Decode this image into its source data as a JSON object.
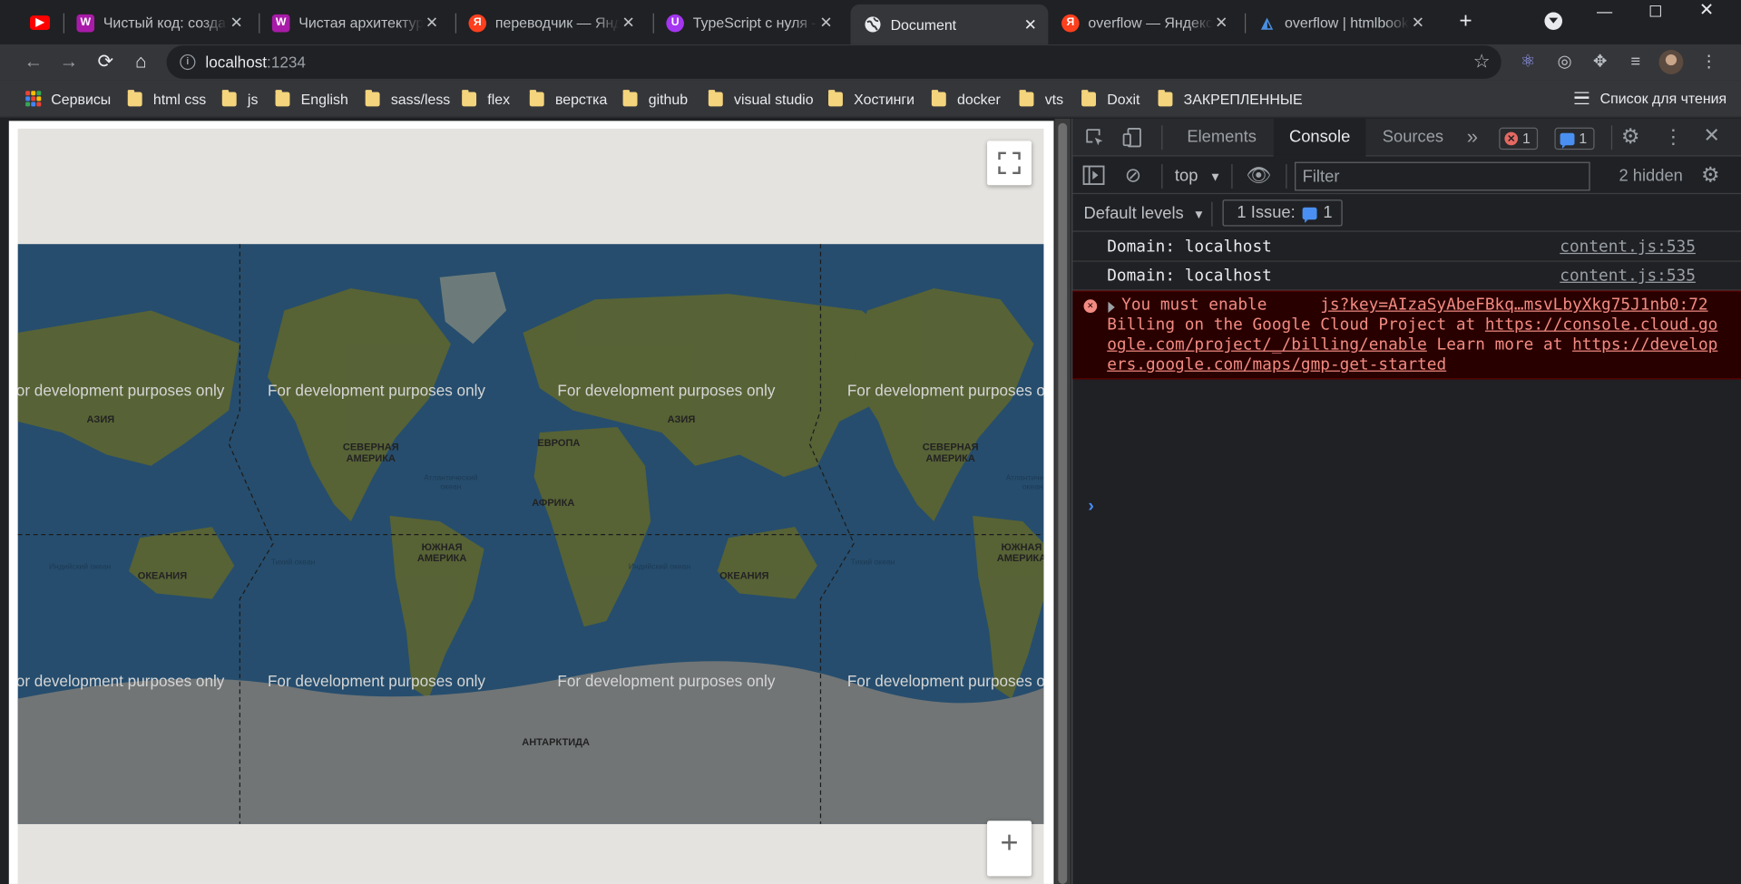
{
  "browser": {
    "tabs": [
      {
        "title": "",
        "favicon": "youtube-icon",
        "color": "#ff0000",
        "active": false
      },
      {
        "title": "Чистый код: создани",
        "favicon": "wildberries-icon",
        "color": "#a81ba8",
        "active": false
      },
      {
        "title": "Чистая архитектура.",
        "favicon": "wildberries-icon",
        "color": "#a81ba8",
        "active": false
      },
      {
        "title": "переводчик — Яндек",
        "favicon": "yandex-icon",
        "color": "#fc3f1d",
        "active": false
      },
      {
        "title": "TypeScript с нуля - с",
        "favicon": "udemy-icon",
        "color": "#a435f0",
        "active": false
      },
      {
        "title": "Document",
        "favicon": "globe-icon",
        "color": "#e8eaed",
        "active": true
      },
      {
        "title": "overflow — Яндекс:",
        "favicon": "yandex-icon",
        "color": "#fc3f1d",
        "active": false
      },
      {
        "title": "overflow | htmlbook.",
        "favicon": "htmlbook-icon",
        "color": "#1f6fb5",
        "active": false
      }
    ],
    "url_host": "localhost",
    "url_port": ":1234",
    "bookmarks": [
      {
        "label": "Сервисы",
        "type": "apps"
      },
      {
        "label": "html css",
        "type": "folder"
      },
      {
        "label": "js",
        "type": "folder"
      },
      {
        "label": "English",
        "type": "folder"
      },
      {
        "label": "sass/less",
        "type": "folder"
      },
      {
        "label": "flex",
        "type": "folder"
      },
      {
        "label": "верстка",
        "type": "folder"
      },
      {
        "label": "github",
        "type": "folder"
      },
      {
        "label": "visual studio",
        "type": "folder"
      },
      {
        "label": "Хостинги",
        "type": "folder"
      },
      {
        "label": "docker",
        "type": "folder"
      },
      {
        "label": "vts",
        "type": "folder"
      },
      {
        "label": "Doxit",
        "type": "folder"
      },
      {
        "label": "ЗАКРЕПЛЕННЫЕ",
        "type": "folder"
      }
    ],
    "reading_list": "Список для чтения"
  },
  "map": {
    "watermark": "For development purposes only",
    "labels": {
      "asia": "АЗИЯ",
      "north_america": "СЕВЕРНАЯ АМЕРИКА",
      "europe": "ЕВРОПА",
      "africa": "АФРИКА",
      "south_america": "ЮЖНАЯ АМЕРИКА",
      "oceania": "ОКЕАНИЯ",
      "antarctica": "АНТАРКТИДА",
      "atlantic": "Атлантический океан",
      "indian": "Индийский океан",
      "pacific": "Тихий океан"
    },
    "zoom_in": "+"
  },
  "devtools": {
    "tabs": [
      "Elements",
      "Console",
      "Sources"
    ],
    "active_tab": "Console",
    "error_count": "1",
    "message_count": "1",
    "context": "top",
    "filter_placeholder": "Filter",
    "hidden": "2 hidden",
    "levels": "Default levels",
    "issues_label": "1 Issue:",
    "issues_count": "1",
    "logs": [
      {
        "message": "Domain: localhost",
        "source": "content.js:535"
      },
      {
        "message": "Domain: localhost",
        "source": "content.js:535"
      }
    ],
    "error": {
      "line1": "You must enable",
      "source": "js?key=AIzaSyAbeFBkq…msvLbyXkg75J1nb0:72",
      "line2_text": "Billing on the Google Cloud Project at ",
      "link1_a": "https://console.cloud.go",
      "link1_b": "ogle.com/project/_/billing/enable",
      "learn": " Learn more at ",
      "link2_a": "https://develop",
      "link2_b": "ers.google.com/maps/gmp-get-started"
    }
  }
}
